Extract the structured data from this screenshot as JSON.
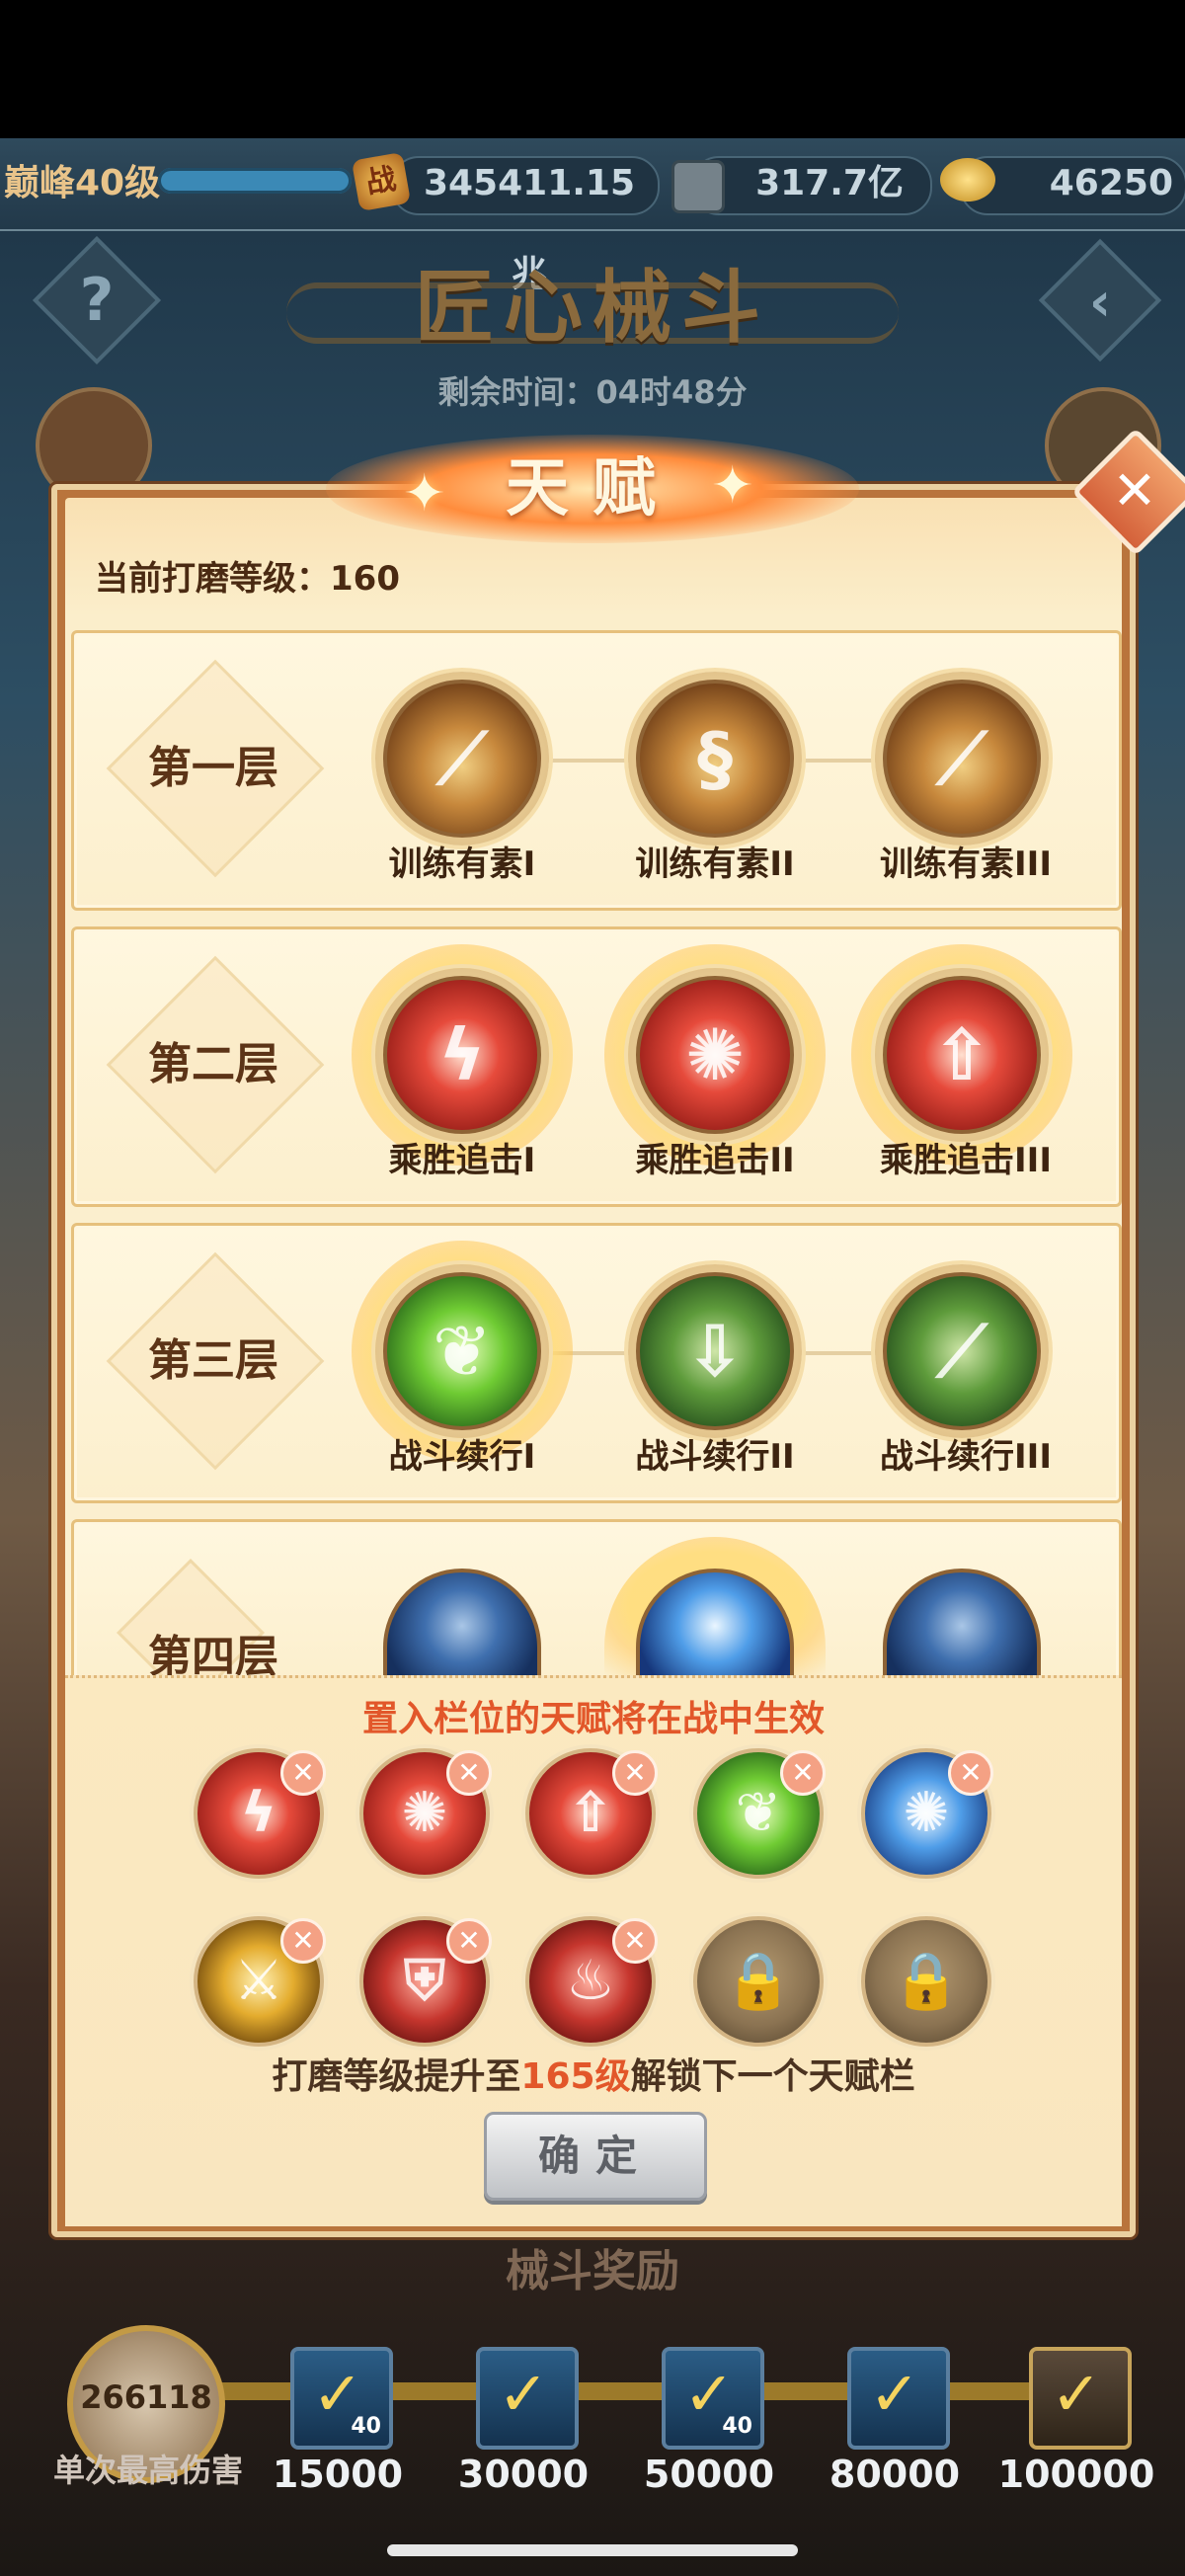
{
  "topbar": {
    "level_label": "巅峰40级",
    "power_icon_text": "战",
    "power_value": "345411.15兆",
    "coins_value": "317.7亿",
    "gold_value": "46250"
  },
  "event": {
    "title": "匠心械斗",
    "remaining_time": "剩余时间：04时48分",
    "help_icon": "question-icon",
    "back_icon": "back-arrow-icon"
  },
  "dialog": {
    "title": "天赋",
    "close_icon": "close-icon",
    "current_level": "当前打磨等级：160",
    "layers": [
      {
        "label": "第一层",
        "talents": [
          {
            "name": "训练有素I",
            "icon": "brown-claw-icon"
          },
          {
            "name": "训练有素II",
            "icon": "brown-flame-icon"
          },
          {
            "name": "训练有素III",
            "icon": "brown-slash-icon"
          }
        ]
      },
      {
        "label": "第二层",
        "talents": [
          {
            "name": "乘胜追击I",
            "icon": "red-slash-icon"
          },
          {
            "name": "乘胜追击II",
            "icon": "red-vortex-icon"
          },
          {
            "name": "乘胜追击III",
            "icon": "red-arrow-icon"
          }
        ]
      },
      {
        "label": "第三层",
        "talents": [
          {
            "name": "战斗续行I",
            "icon": "green-leaf-icon"
          },
          {
            "name": "战斗续行II",
            "icon": "green-arrow-icon"
          },
          {
            "name": "战斗续行III",
            "icon": "green-slash-icon"
          }
        ]
      },
      {
        "label": "第四层",
        "talents": [
          {
            "name": "",
            "icon": "blue-claw-icon"
          },
          {
            "name": "",
            "icon": "blue-vortex-icon"
          },
          {
            "name": "",
            "icon": "blue-arrow-icon"
          }
        ]
      }
    ],
    "slots_hint": "置入栏位的天赋将在战中生效",
    "slots": [
      {
        "icon": "red-slash-icon",
        "removable": true
      },
      {
        "icon": "red-vortex-icon",
        "removable": true
      },
      {
        "icon": "red-arrow-icon",
        "removable": true
      },
      {
        "icon": "green-leaf-icon",
        "removable": true
      },
      {
        "icon": "blue-vortex-icon",
        "removable": true
      },
      {
        "icon": "gold-sword-icon",
        "removable": true
      },
      {
        "icon": "red-shield-icon",
        "removable": true
      },
      {
        "icon": "red-emblem-icon",
        "removable": true
      },
      {
        "icon": "lock-icon",
        "removable": false
      },
      {
        "icon": "lock-icon",
        "removable": false
      }
    ],
    "unlock_hint_prefix": "打磨等级提升至",
    "unlock_hint_level": "165级",
    "unlock_hint_suffix": "解锁下一个天赋栏",
    "confirm_label": "确定"
  },
  "rewards": {
    "title": "械斗奖励",
    "max_damage_value": "266118",
    "max_damage_label": "单次最高伤害",
    "tiers": [
      {
        "threshold": "15000",
        "qty": "40"
      },
      {
        "threshold": "30000",
        "qty": ""
      },
      {
        "threshold": "50000",
        "qty": "40"
      },
      {
        "threshold": "80000",
        "qty": ""
      },
      {
        "threshold": "100000",
        "qty": ""
      }
    ]
  }
}
